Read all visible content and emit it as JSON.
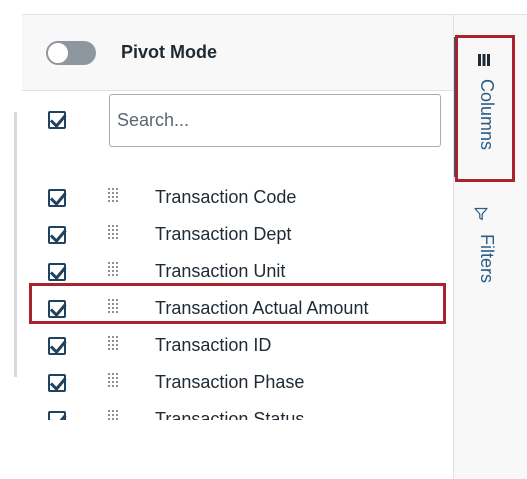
{
  "header": {
    "pivot_mode_label": "Pivot Mode",
    "pivot_mode_on": false
  },
  "search": {
    "placeholder": "Search...",
    "value": "",
    "select_all_checked": true
  },
  "columns": [
    {
      "label": "Transaction Code",
      "checked": true
    },
    {
      "label": "Transaction Dept",
      "checked": true
    },
    {
      "label": "Transaction Unit",
      "checked": true
    },
    {
      "label": "Transaction Actual Amount",
      "checked": true,
      "highlighted": true
    },
    {
      "label": "Transaction ID",
      "checked": true
    },
    {
      "label": "Transaction Phase",
      "checked": true
    },
    {
      "label": "Transaction Status",
      "checked": true
    }
  ],
  "side_tabs": {
    "columns_label": "Columns",
    "columns_icon": "columns-icon",
    "filters_label": "Filters",
    "filters_icon": "filter-icon",
    "active": "Columns"
  },
  "colors": {
    "accent": "#2a5d86",
    "checkbox": "#20425f",
    "highlight": "#a8232b"
  }
}
